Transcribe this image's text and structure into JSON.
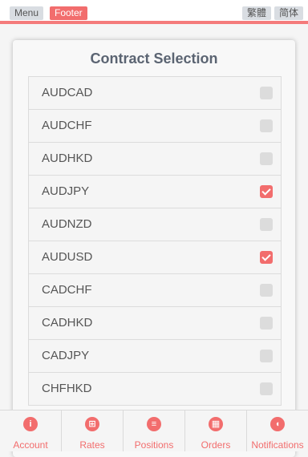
{
  "topbar": {
    "menu_label": "Menu",
    "footer_label": "Footer",
    "traditional_label": "繁體",
    "simplified_label": "简体"
  },
  "card": {
    "title": "Contract Selection"
  },
  "contracts": [
    {
      "name": "AUDCAD",
      "checked": false
    },
    {
      "name": "AUDCHF",
      "checked": false
    },
    {
      "name": "AUDHKD",
      "checked": false
    },
    {
      "name": "AUDJPY",
      "checked": true
    },
    {
      "name": "AUDNZD",
      "checked": false
    },
    {
      "name": "AUDUSD",
      "checked": true
    },
    {
      "name": "CADCHF",
      "checked": false
    },
    {
      "name": "CADHKD",
      "checked": false
    },
    {
      "name": "CADJPY",
      "checked": false
    },
    {
      "name": "CHFHKD",
      "checked": false
    }
  ],
  "nav": [
    {
      "label": "Account",
      "icon": "info-icon",
      "glyph": "i"
    },
    {
      "label": "Rates",
      "icon": "grid-icon",
      "glyph": "⊞"
    },
    {
      "label": "Positions",
      "icon": "list-icon",
      "glyph": "≡"
    },
    {
      "label": "Orders",
      "icon": "calculator-icon",
      "glyph": "▦"
    },
    {
      "label": "Notifications",
      "icon": "speaker-icon",
      "glyph": "◖"
    }
  ],
  "colors": {
    "accent": "#f26d6d",
    "checkbox_off": "#dcdcdc",
    "text": "#555555"
  }
}
